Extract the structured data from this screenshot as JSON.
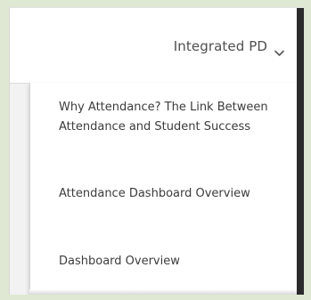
{
  "nav": {
    "label": "Integrated PD",
    "icon": "chevron-down-icon"
  },
  "menu": {
    "items": [
      {
        "label": "Why Attendance? The Link Between Attendance and Student Success"
      },
      {
        "label": "Attendance Dashboard Overview"
      },
      {
        "label": "Dashboard Overview"
      }
    ]
  },
  "colors": {
    "page_background": "#dfe8d2",
    "text": "#3c3c3c",
    "accent_dark": "#2b2b2b"
  }
}
